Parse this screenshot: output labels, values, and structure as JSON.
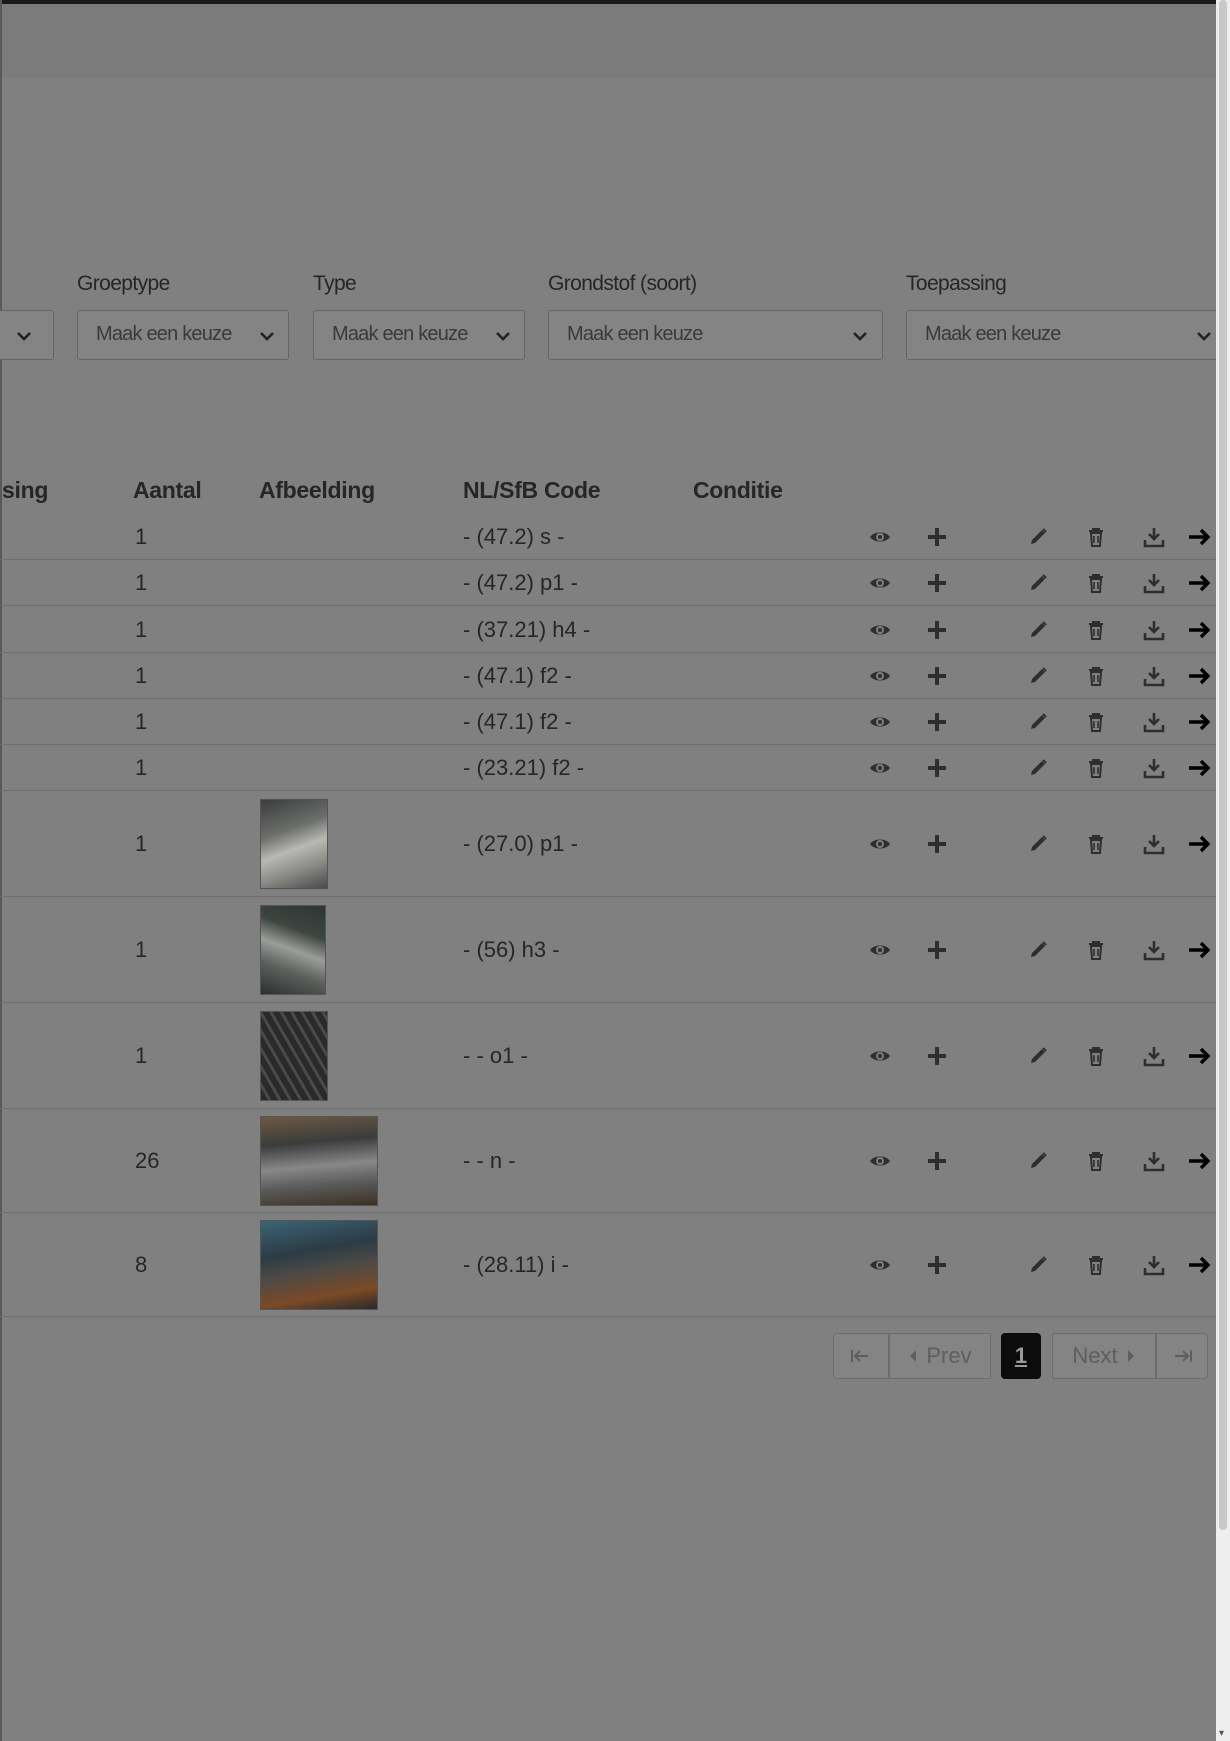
{
  "filters": {
    "partial_select": {
      "value": ""
    },
    "groeptype": {
      "label": "Groeptype",
      "value": "Maak een keuze"
    },
    "type": {
      "label": "Type",
      "value": "Maak een keuze"
    },
    "grondstof": {
      "label": "Grondstof (soort)",
      "value": "Maak een keuze"
    },
    "toepassing": {
      "label": "Toepassing",
      "value": "Maak een keuze"
    }
  },
  "table": {
    "headers": {
      "toepassing_partial": "sing",
      "aantal": "Aantal",
      "afbeelding": "Afbeelding",
      "code": "NL/SfB Code",
      "conditie": "Conditie"
    },
    "rows": [
      {
        "aantal": "1",
        "code": "- (47.2) s -",
        "image": null
      },
      {
        "aantal": "1",
        "code": "- (47.2) p1 -",
        "image": null
      },
      {
        "aantal": "1",
        "code": "- (37.21) h4 -",
        "image": null
      },
      {
        "aantal": "1",
        "code": "- (47.1) f2 -",
        "image": null
      },
      {
        "aantal": "1",
        "code": "- (47.1) f2 -",
        "image": null
      },
      {
        "aantal": "1",
        "code": "- (23.21) f2 -",
        "image": null
      },
      {
        "aantal": "1",
        "code": "- (27.0) p1 -",
        "image": "photo-white-panel"
      },
      {
        "aantal": "1",
        "code": "- (56) h3 -",
        "image": "photo-hvac-unit"
      },
      {
        "aantal": "1",
        "code": "- - o1 -",
        "image": "photo-steel-frame"
      },
      {
        "aantal": "26",
        "code": "- - n -",
        "image": "photo-roof-beams"
      },
      {
        "aantal": "8",
        "code": "- (28.11) i -",
        "image": "photo-hall-interior"
      }
    ],
    "row_actions": [
      "view-icon",
      "add-icon",
      "edit-icon",
      "delete-icon",
      "download-icon",
      "arrow-right-icon"
    ]
  },
  "pagination": {
    "first": "",
    "prev": "Prev",
    "current": "1",
    "next": "Next",
    "last": ""
  },
  "colors": {
    "overlay_background": "#808080",
    "active_page": "#0c0c0c"
  }
}
